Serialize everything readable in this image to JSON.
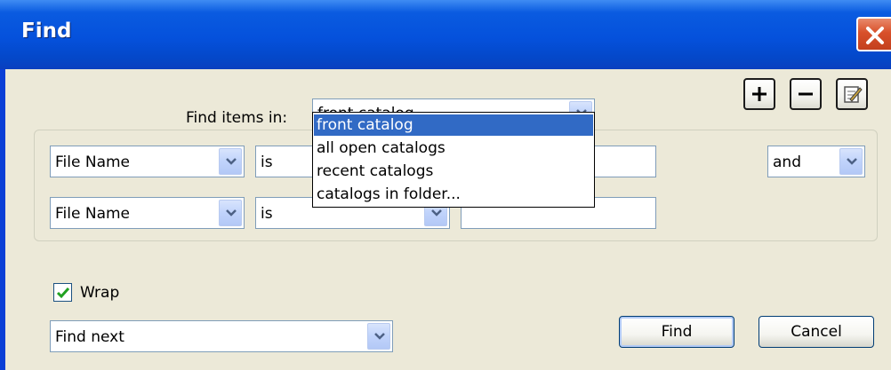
{
  "window": {
    "title": "Find",
    "close_icon": "close-icon"
  },
  "find_in": {
    "label": "Find items in:",
    "value": "front catalog",
    "options": [
      "front catalog",
      "all open catalogs",
      "recent catalogs",
      "catalogs in folder..."
    ],
    "selected_option": "front catalog"
  },
  "toolbar": {
    "add_icon": "plus-icon",
    "remove_icon": "minus-icon",
    "edit_icon": "edit-icon"
  },
  "criteria": [
    {
      "field": "File Name",
      "operator": "is",
      "value": "",
      "conjunction": "and"
    },
    {
      "field": "File Name",
      "operator": "is",
      "value": ""
    }
  ],
  "options": {
    "wrap_label": "Wrap",
    "wrap_checked": true,
    "mode_value": "Find next"
  },
  "buttons": {
    "find": "Find",
    "cancel": "Cancel"
  },
  "colors": {
    "title_bar": "#0551dc",
    "dialog_bg": "#ece9d8",
    "selection": "#316ac5",
    "close": "#d8502a"
  }
}
